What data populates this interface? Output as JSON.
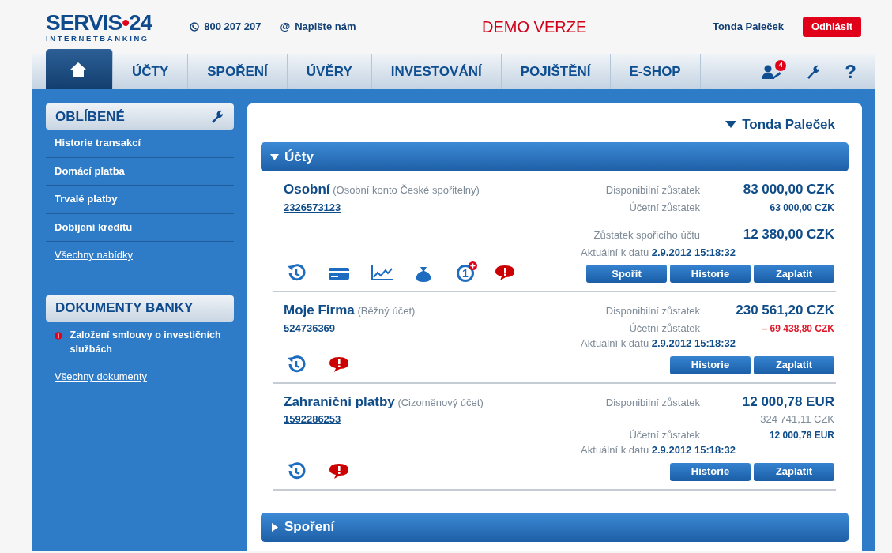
{
  "header": {
    "logo": {
      "name": "SERVIS",
      "dot": "•",
      "number": "24",
      "tagline": "INTERNETBANKING"
    },
    "phone": "800 207 207",
    "contact_icon": "@",
    "contact": "Napište nám",
    "demo": "DEMO VERZE",
    "user": "Tonda Paleček",
    "logout": "Odhlásit"
  },
  "nav": {
    "tabs": [
      {
        "kind": "home",
        "selected": true
      },
      {
        "kind": "text",
        "label": "ÚČTY",
        "selected": false
      },
      {
        "kind": "text",
        "label": "SPOŘENÍ",
        "selected": false
      },
      {
        "kind": "text",
        "label": "ÚVĚRY",
        "selected": false
      },
      {
        "kind": "text",
        "label": "INVESTOVÁNÍ",
        "selected": false
      },
      {
        "kind": "text",
        "label": "POJIŠTĚNÍ",
        "selected": false
      },
      {
        "kind": "text",
        "label": "E-SHOP",
        "selected": false
      }
    ],
    "messages_badge": "4",
    "help": "?"
  },
  "sidebar": {
    "favorites": {
      "title": "OBLÍBENÉ",
      "items": [
        "Historie transakcí",
        "Domácí platba",
        "Trvalé platby",
        "Dobíjení kreditu"
      ],
      "more": "Všechny nabídky"
    },
    "documents": {
      "title": "DOKUMENTY BANKY",
      "items": [
        {
          "text": "Založení smlouvy o investičních službách",
          "alert": true
        }
      ],
      "more": "Všechny dokumenty"
    }
  },
  "main": {
    "user": "Tonda Paleček",
    "sections": [
      {
        "title": "Účty",
        "expanded": true,
        "accounts": [
          {
            "name": "Osobní",
            "type": "(Osobní konto České spořitelny)",
            "number": "2326573123",
            "balances": [
              {
                "kind": "primary",
                "label": "Disponibilní zůstatek",
                "amount": "83 000,00 CZK"
              },
              {
                "kind": "secondary",
                "label": "Účetní zůstatek",
                "amount": "63 000,00 CZK"
              },
              {
                "kind": "primary",
                "label": "Zůstatek spořicího účtu",
                "amount": "12 380,00 CZK",
                "separated": true
              }
            ],
            "updated_label": "Aktuální k datu",
            "updated": "2.9.2012 15:18:32",
            "icons": [
              {
                "kind": "history"
              },
              {
                "kind": "card"
              },
              {
                "kind": "chart"
              },
              {
                "kind": "bag"
              },
              {
                "kind": "day",
                "text": "1"
              },
              {
                "kind": "alert"
              }
            ],
            "buttons": [
              "Spořit",
              "Historie",
              "Zaplatit"
            ]
          },
          {
            "name": "Moje Firma",
            "type": "(Běžný účet)",
            "number": "524736369",
            "balances": [
              {
                "kind": "primary",
                "label": "Disponibilní zůstatek",
                "amount": "230 561,20 CZK"
              },
              {
                "kind": "negative",
                "label": "Účetní zůstatek",
                "amount": "– 69 438,80 CZK"
              }
            ],
            "updated_label": "Aktuální k datu",
            "updated": "2.9.2012 15:18:32",
            "icons": [
              {
                "kind": "history"
              },
              {
                "kind": "alert"
              }
            ],
            "buttons": [
              "Historie",
              "Zaplatit"
            ]
          },
          {
            "name": "Zahraniční platby",
            "type": "(Cizoměnový účet)",
            "number": "1592286253",
            "balances": [
              {
                "kind": "primary",
                "label": "Disponibilní zůstatek",
                "amount": "12 000,78 EUR"
              },
              {
                "kind": "converted",
                "amount": "324 741,11 CZK"
              },
              {
                "kind": "secondary",
                "label": "Účetní zůstatek",
                "amount": "12 000,78 EUR"
              }
            ],
            "updated_label": "Aktuální k datu",
            "updated": "2.9.2012 15:18:32",
            "icons": [
              {
                "kind": "history"
              },
              {
                "kind": "alert"
              }
            ],
            "buttons": [
              "Historie",
              "Zaplatit"
            ]
          }
        ]
      },
      {
        "title": "Spoření",
        "expanded": false
      }
    ]
  }
}
